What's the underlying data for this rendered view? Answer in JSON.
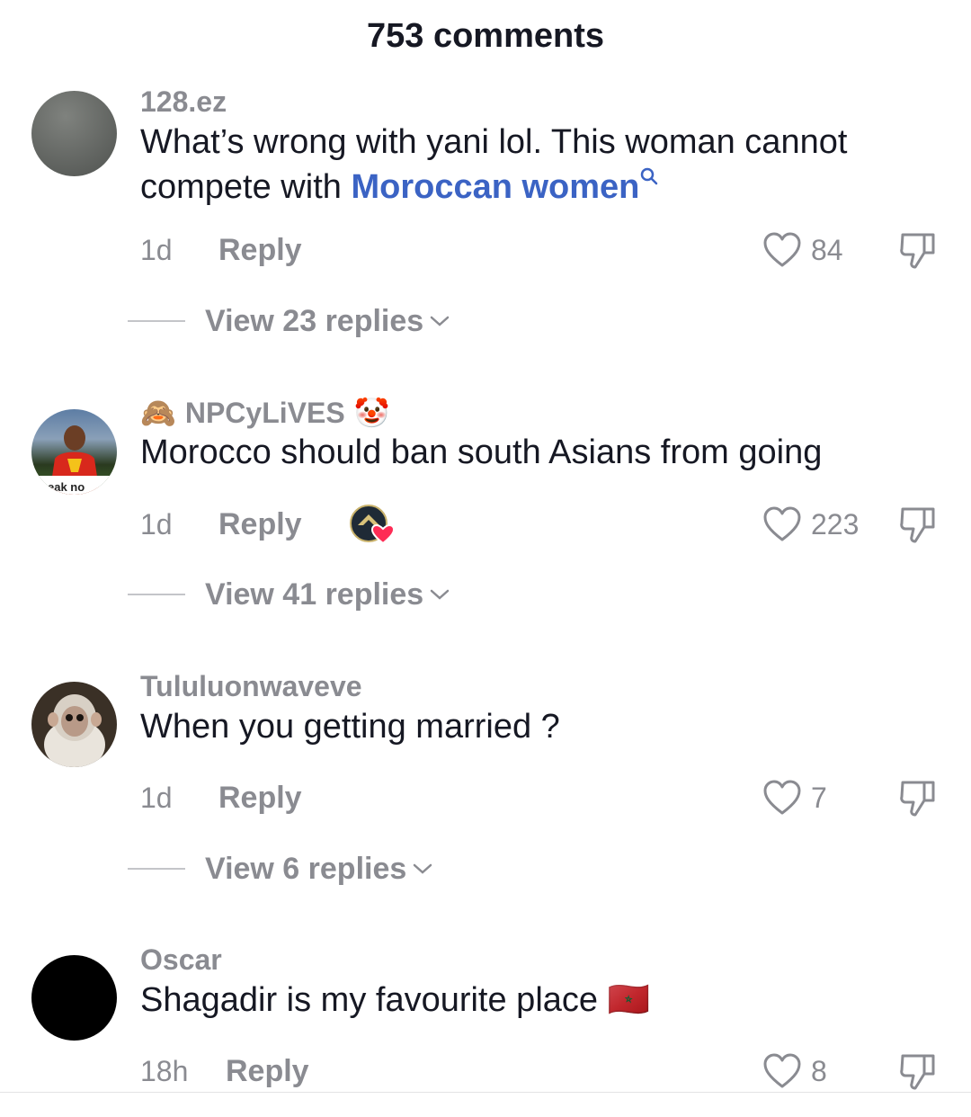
{
  "header": {
    "title": "753 comments"
  },
  "comments": [
    {
      "username": "128.ez",
      "text_before": "What’s wrong with yani lol. This woman cannot compete with ",
      "link": "Moroccan women",
      "time": "1d",
      "reply_label": "Reply",
      "likes": "84",
      "view_replies": "View 23 replies"
    },
    {
      "username_prefix_emoji": "🙈",
      "username": "NPCyLiVES",
      "username_suffix_emoji": "🤡",
      "text": "Morocco should ban south Asians from going",
      "time": "1d",
      "reply_label": "Reply",
      "likes": "223",
      "view_replies": "View 41 replies",
      "avatar_caption": "eak no"
    },
    {
      "username": "Tululuonwaveve",
      "text": "When you getting married ?",
      "time": "1d",
      "reply_label": "Reply",
      "likes": "7",
      "view_replies": "View 6 replies"
    },
    {
      "username": "Oscar",
      "text": "Shagadir is my favourite place",
      "flag_emoji": "🇲🇦",
      "time": "18h",
      "reply_label": "Reply",
      "likes": "8"
    }
  ],
  "colors": {
    "primary_text": "#161823",
    "secondary_text": "#8a8b91",
    "link": "#3b63c4",
    "heart_badge": "#fe2c55"
  },
  "icons": [
    "heart-outline-icon",
    "dislike-icon",
    "chevron-down-icon",
    "search-icon"
  ]
}
